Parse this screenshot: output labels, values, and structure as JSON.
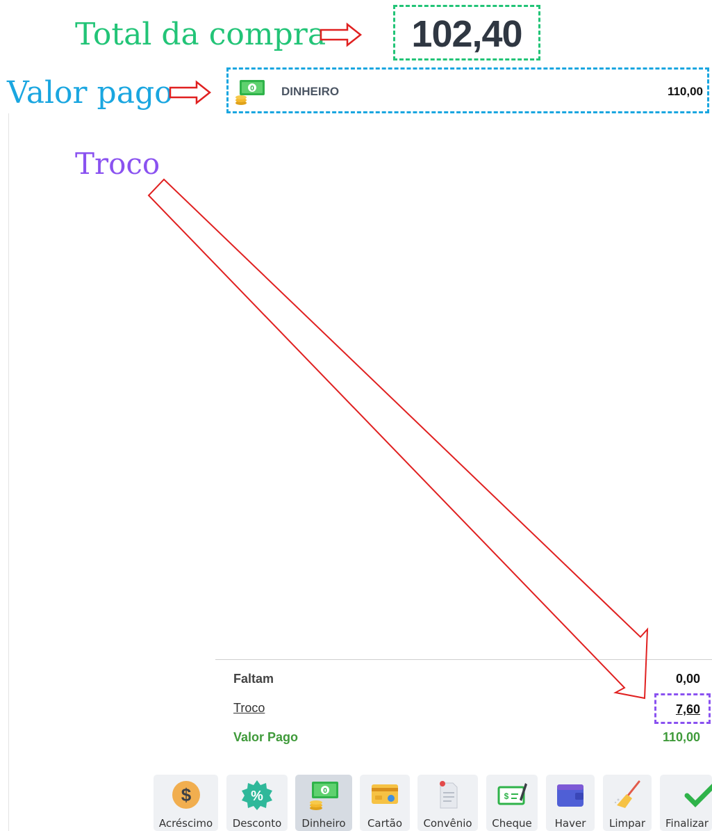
{
  "annotations": {
    "total_label": "Total da compra",
    "valor_pago_label": "Valor pago",
    "troco_label": "Troco"
  },
  "total": {
    "value": "102,40"
  },
  "payment": {
    "method": "DINHEIRO",
    "amount": "110,00",
    "icon": "cash-money-icon"
  },
  "summary": {
    "faltam_label": "Faltam",
    "faltam_value": "0,00",
    "troco_label": "Troco",
    "troco_value": "7,60",
    "valor_pago_label": "Valor Pago",
    "valor_pago_value": "110,00"
  },
  "toolbar": {
    "acrescimo": "Acréscimo",
    "desconto": "Desconto",
    "dinheiro": "Dinheiro",
    "cartao": "Cartão",
    "convenio": "Convênio",
    "cheque": "Cheque",
    "haver": "Haver",
    "limpar": "Limpar",
    "finalizar": "Finalizar"
  },
  "colors": {
    "annotation_green": "#22c477",
    "annotation_blue": "#1aa6e0",
    "annotation_purple": "#8a52f0",
    "arrow_red": "#e02020",
    "paid_green": "#3f9a3a"
  }
}
